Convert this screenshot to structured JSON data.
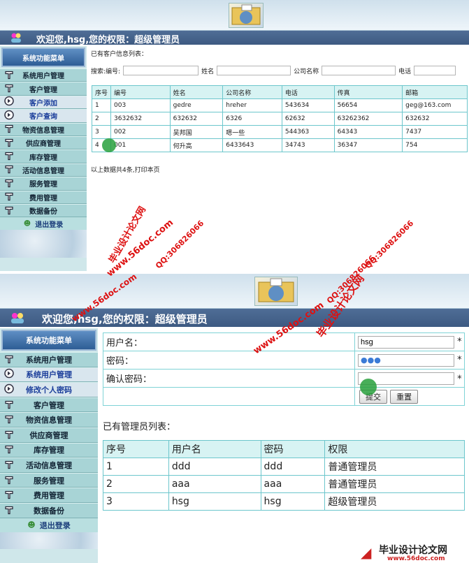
{
  "panel1": {
    "welcome": "欢迎您,hsg,您的权限：超级管理员",
    "menu_header": "系统功能菜单",
    "menu": [
      {
        "label": "系统用户管理",
        "icon": "wrench-icon",
        "sub": false
      },
      {
        "label": "客户管理",
        "icon": "wrench-icon",
        "sub": false
      },
      {
        "label": "客户添加",
        "icon": "arrow-circle-icon",
        "sub": true
      },
      {
        "label": "客户查询",
        "icon": "arrow-circle-icon",
        "sub": true
      },
      {
        "label": "物资信息管理",
        "icon": "wrench-icon",
        "sub": false
      },
      {
        "label": "供应商管理",
        "icon": "wrench-icon",
        "sub": false
      },
      {
        "label": "库存管理",
        "icon": "wrench-icon",
        "sub": false
      },
      {
        "label": "活动信息管理",
        "icon": "wrench-icon",
        "sub": false
      },
      {
        "label": "服务管理",
        "icon": "wrench-icon",
        "sub": false
      },
      {
        "label": "费用管理",
        "icon": "wrench-icon",
        "sub": false
      },
      {
        "label": "数据备份",
        "icon": "wrench-icon",
        "sub": false
      }
    ],
    "logout": "退出登录",
    "list_title": "已有客户信息列表：",
    "search": {
      "label_no": "搜索:编号:",
      "label_name": "姓名",
      "label_company": "公司名称",
      "label_phone": "电话"
    },
    "table_headers": [
      "序号",
      "编号",
      "姓名",
      "公司名称",
      "电话",
      "传真",
      "邮箱"
    ],
    "rows": [
      [
        "1",
        "003",
        "gedre",
        "hreher",
        "543634",
        "56654",
        "geg@163.com"
      ],
      [
        "2",
        "3632632",
        "632632",
        "6326",
        "62632",
        "63262362",
        "632632"
      ],
      [
        "3",
        "002",
        "吴邦国",
        "嗯一些",
        "544363",
        "64343",
        "7437"
      ],
      [
        "4",
        "001",
        "何升高",
        "6433643",
        "34743",
        "36347",
        "754"
      ]
    ],
    "footer": "以上数据共4条,打印本页"
  },
  "panel2": {
    "welcome": "欢迎您,hsg,您的权限：超级管理员",
    "menu_header": "系统功能菜单",
    "menu": [
      {
        "label": "系统用户管理",
        "icon": "wrench-icon",
        "sub": false
      },
      {
        "label": "系统用户管理",
        "icon": "arrow-circle-icon",
        "sub": true
      },
      {
        "label": "修改个人密码",
        "icon": "arrow-circle-icon",
        "sub": true
      },
      {
        "label": "客户管理",
        "icon": "wrench-icon",
        "sub": false
      },
      {
        "label": "物资信息管理",
        "icon": "wrench-icon",
        "sub": false
      },
      {
        "label": "供应商管理",
        "icon": "wrench-icon",
        "sub": false
      },
      {
        "label": "库存管理",
        "icon": "wrench-icon",
        "sub": false
      },
      {
        "label": "活动信息管理",
        "icon": "wrench-icon",
        "sub": false
      },
      {
        "label": "服务管理",
        "icon": "wrench-icon",
        "sub": false
      },
      {
        "label": "费用管理",
        "icon": "wrench-icon",
        "sub": false
      },
      {
        "label": "数据备份",
        "icon": "wrench-icon",
        "sub": false
      }
    ],
    "logout": "退出登录",
    "form": {
      "username_label": "用户名：",
      "username_value": "hsg",
      "required": "*",
      "password_label": "密码：",
      "password_value": "●●●",
      "confirm_label": "确认密码：",
      "confirm_value": "",
      "submit": "提交",
      "reset": "重置"
    },
    "list_title": "已有管理员列表：",
    "table_headers": [
      "序号",
      "用户名",
      "密码",
      "权限"
    ],
    "rows": [
      [
        "1",
        "ddd",
        "ddd",
        "普通管理员"
      ],
      [
        "2",
        "aaa",
        "aaa",
        "普通管理员"
      ],
      [
        "3",
        "hsg",
        "hsg",
        "超级管理员"
      ]
    ]
  },
  "watermarks": {
    "site": "www.56doc.com",
    "brand": "毕业设计论文网",
    "qq": "QQ:306826066",
    "footer_brand": "毕业设计论文网",
    "footer_site": "www.56doc.com"
  },
  "colors": {
    "accent": "#3d5a82",
    "table_border": "#6cc6cc",
    "menu": "#a8d4d6",
    "watermark": "#dd1111"
  }
}
